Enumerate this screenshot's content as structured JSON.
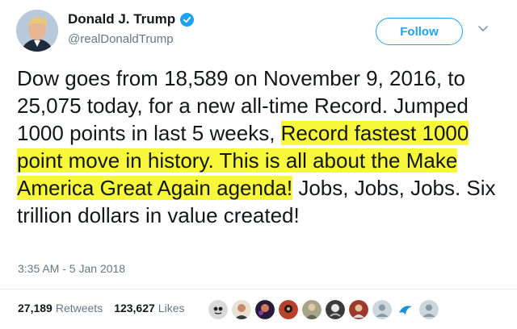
{
  "author": {
    "display_name": "Donald J. Trump",
    "handle": "@realDonaldTrump",
    "verified": true
  },
  "follow_button": {
    "label": "Follow"
  },
  "tweet": {
    "text_plain": "Dow goes from 18,589 on November 9, 2016, to 25,075 today, for a new all-time Record. Jumped 1000 points in last 5 weeks, ",
    "text_highlighted": "Record fastest 1000 point move in history. This is all about the Make America Great Again agenda!",
    "text_after": " Jobs, Jobs, Jobs. Six trillion dollars in value created!",
    "highlight_color": "#f7f83b",
    "timestamp": "3:35 AM - 5 Jan 2018"
  },
  "stats": {
    "retweets_count": "27,189",
    "retweets_label": "Retweets",
    "likes_count": "123,627",
    "likes_label": "Likes"
  },
  "likers": [
    {
      "icon": "avatar-1"
    },
    {
      "icon": "avatar-2"
    },
    {
      "icon": "avatar-3"
    },
    {
      "icon": "avatar-4"
    },
    {
      "icon": "avatar-5"
    },
    {
      "icon": "avatar-6"
    },
    {
      "icon": "avatar-default"
    },
    {
      "icon": "avatar-blue-logo"
    },
    {
      "icon": "avatar-default"
    }
  ],
  "colors": {
    "accent": "#1da1f2",
    "text": "#14171a",
    "muted": "#657786",
    "divider": "#e6ecf0"
  }
}
